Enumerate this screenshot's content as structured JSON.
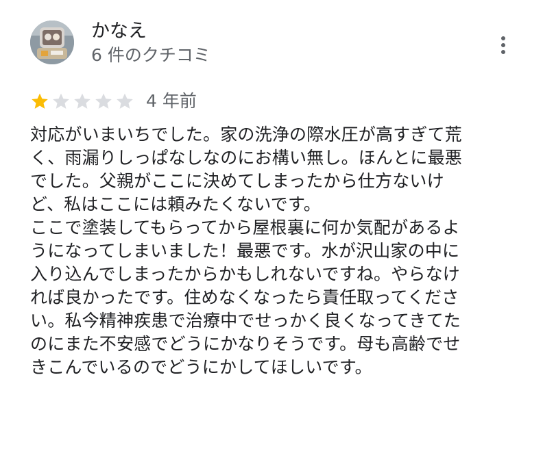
{
  "review": {
    "reviewer_name": "かなえ",
    "reviewer_meta": "6 件のクチコミ",
    "more_icon": "more-vert-icon",
    "rating": {
      "value": 1,
      "max": 5
    },
    "date": "4 年前",
    "star_colors": {
      "filled": "#fbbc04",
      "empty": "#dadce0"
    },
    "text_lines": [
      "対応がいまいちでした。家の洗浄の際水圧が高すぎて荒",
      "く、雨漏りしっぱなしなのにお構い無し。ほんとに最悪",
      "でした。父親がここに決めてしまったから仕方ないけ",
      "ど、私はここには頼みたくないです。",
      "ここで塗装してもらってから屋根裏に何か気配があるよ",
      "うになってしまいました！最悪です。水が沢山家の中に",
      "入り込んでしまったからかもしれないですね。やらなけ",
      "れば良かったです。住めなくなったら責任取ってくださ",
      "い。私今精神疾患で治療中でせっかく良くなってきてた",
      "のにまた不安感でどうにかなりそうです。母も高齢でせ",
      "きこんでいるのでどうにかしてほしいです。"
    ]
  }
}
